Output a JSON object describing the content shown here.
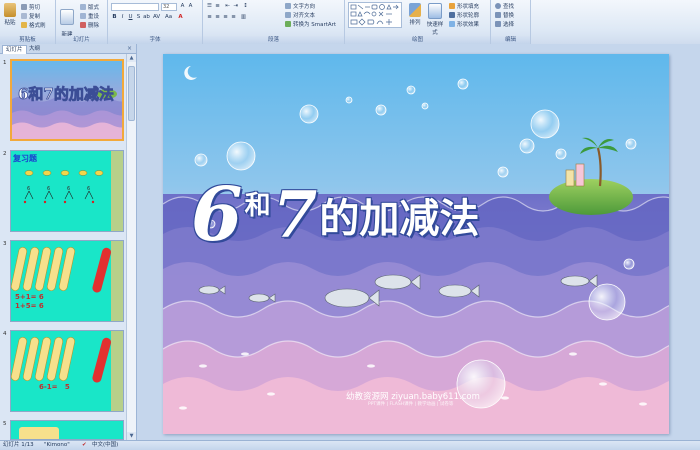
{
  "ribbon": {
    "clipboard": {
      "paste": "粘贴",
      "cut": "剪切",
      "copy": "复制",
      "format_painter": "格式刷",
      "group": "剪贴板"
    },
    "slides": {
      "new_slide": "新建\n幻灯片",
      "layout": "版式",
      "reset": "重设",
      "delete": "删除",
      "group": "幻灯片"
    },
    "font": {
      "font_size": "32",
      "group": "字体"
    },
    "paragraph": {
      "text_direction": "文字方向",
      "align_text": "对齐文本",
      "smartart": "转换为 SmartArt",
      "group": "段落"
    },
    "drawing": {
      "arrange": "排列",
      "quick_styles": "快速样式",
      "shape_fill": "形状填充",
      "shape_outline": "形状轮廓",
      "shape_effects": "形状效果",
      "group": "绘图"
    },
    "editing": {
      "find": "查找",
      "replace": "替换",
      "select": "选择",
      "group": "编辑"
    }
  },
  "leftpane": {
    "tabs": [
      {
        "label": "幻灯片"
      },
      {
        "label": "大纲"
      }
    ],
    "close": "×",
    "thumbs": [
      {
        "num": "1",
        "title": "6和7的加减法"
      },
      {
        "num": "2",
        "title": "复习题"
      },
      {
        "num": "3",
        "lines": [
          "5+1= 6",
          "1+5= 6"
        ]
      },
      {
        "num": "4",
        "lines": [
          "6-1=   5"
        ]
      },
      {
        "num": "5"
      }
    ]
  },
  "slide": {
    "title_6": "6",
    "title_he": "和",
    "title_7": "7",
    "title_rest": "的加减法",
    "watermark": "幼教资源网 ziyuan.baby611.com",
    "watermark_small": "PPT课件 | FLASH课件 | 教学动画 | 试卷等"
  },
  "status": {
    "slide_info": "幻灯片 1/13",
    "theme": "\"Kimono\"",
    "language": "中文(中国)"
  },
  "colors": {
    "accent": "#f2a93b",
    "ribbon": "#dde8f5",
    "thumb_green": "#19e6c8"
  }
}
